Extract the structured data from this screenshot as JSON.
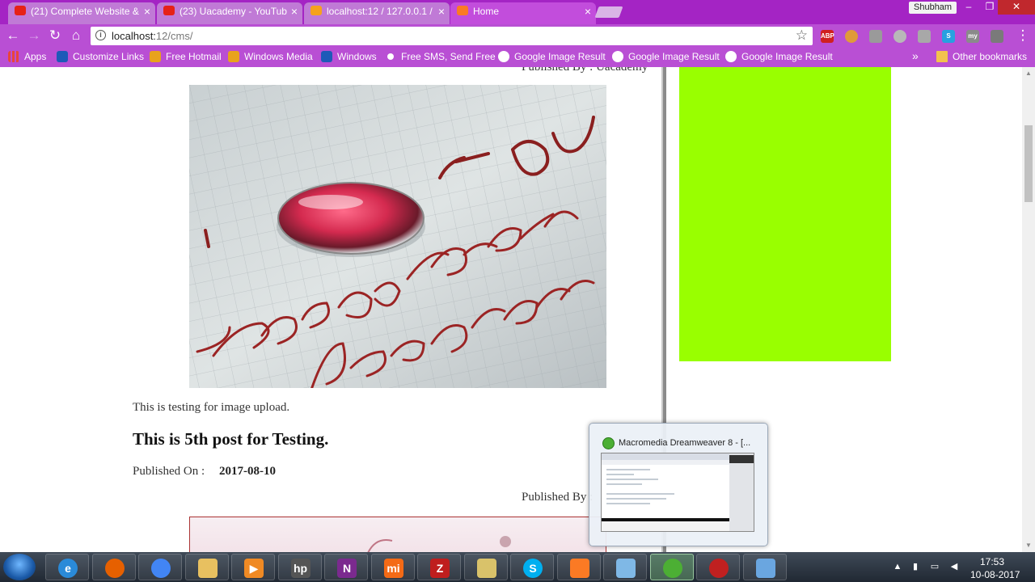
{
  "browser": {
    "tabs": [
      {
        "title": "(21) Complete Website &",
        "icon": "youtube-icon",
        "color": "#e62117"
      },
      {
        "title": "(23) Uacademy - YouTub",
        "icon": "youtube-icon",
        "color": "#e62117"
      },
      {
        "title": "localhost:12 / 127.0.0.1 /",
        "icon": "phpmyadmin-icon",
        "color": "#f6a21c"
      },
      {
        "title": "Home",
        "icon": "xampp-icon",
        "color": "#fb7a24"
      }
    ],
    "user": "Shubham",
    "url_host": "localhost:",
    "url_path": "12/cms/",
    "window_controls": {
      "minimize": "–",
      "maximize": "❐",
      "close": "✕"
    }
  },
  "bookmarks": [
    {
      "label": "Apps",
      "icon": "apps-grid-icon",
      "color": "#e8453c"
    },
    {
      "label": "Customize Links",
      "icon": "msn-icon",
      "color": "#1e5ab8"
    },
    {
      "label": "Free Hotmail",
      "icon": "windows-icon",
      "color": "#e8a21c"
    },
    {
      "label": "Windows Media",
      "icon": "windows-icon",
      "color": "#e8a21c"
    },
    {
      "label": "Windows",
      "icon": "msn-icon",
      "color": "#1e5ab8"
    },
    {
      "label": "Free SMS, Send Free",
      "icon": "chat-bubble-icon",
      "color": "#ffffff"
    },
    {
      "label": "Google Image Result",
      "icon": "google-icon",
      "color": "#ffffff"
    },
    {
      "label": "Google Image Result",
      "icon": "google-icon",
      "color": "#ffffff"
    },
    {
      "label": "Google Image Result",
      "icon": "google-icon",
      "color": "#ffffff"
    }
  ],
  "bookmarks_overflow": "»",
  "other_bookmarks": "Other bookmarks",
  "page": {
    "published_by_top": "Published By :    Uacademy",
    "image_caption": "This is testing for image upload.",
    "image_text": {
      "top": "I   YOU",
      "line1": "I love you Forever",
      "line2": "Alwayz be mine"
    },
    "post_title": "This is 5th post for Testing.",
    "published_on_label": "Published On :",
    "published_on_date": "2017-08-10",
    "published_by": "Published By :",
    "sidebar_color": "#99ff00"
  },
  "taskbar": {
    "preview_title": "Macromedia Dreamweaver 8 - [...",
    "apps": [
      {
        "name": "internet-explorer-icon",
        "glyph": "e",
        "color": "#2a8ad8"
      },
      {
        "name": "firefox-icon",
        "glyph": "",
        "color": "#e66000"
      },
      {
        "name": "chrome-icon",
        "glyph": "",
        "color": "#4285f4"
      },
      {
        "name": "file-explorer-icon",
        "glyph": "",
        "color": "#e8c060"
      },
      {
        "name": "media-player-icon",
        "glyph": "▶",
        "color": "#f08a24"
      },
      {
        "name": "hp-icon",
        "glyph": "hp",
        "color": "#555"
      },
      {
        "name": "onenote-icon",
        "glyph": "N",
        "color": "#7b2a8f"
      },
      {
        "name": "mi-icon",
        "glyph": "mi",
        "color": "#f46a16"
      },
      {
        "name": "filezilla-icon",
        "glyph": "Z",
        "color": "#bf1e1e"
      },
      {
        "name": "folder-icon",
        "glyph": "",
        "color": "#d9c26a"
      },
      {
        "name": "skype-icon",
        "glyph": "S",
        "color": "#00aff0"
      },
      {
        "name": "xampp-icon",
        "glyph": "",
        "color": "#fb7a24"
      },
      {
        "name": "notepad-icon",
        "glyph": "",
        "color": "#7fb8e6"
      },
      {
        "name": "dreamweaver-icon",
        "glyph": "",
        "color": "#4caf34"
      },
      {
        "name": "target-icon",
        "glyph": "",
        "color": "#c02020"
      },
      {
        "name": "control-panel-icon",
        "glyph": "",
        "color": "#6aa6e0"
      }
    ],
    "clock_time": "17:53",
    "clock_date": "10-08-2017"
  }
}
